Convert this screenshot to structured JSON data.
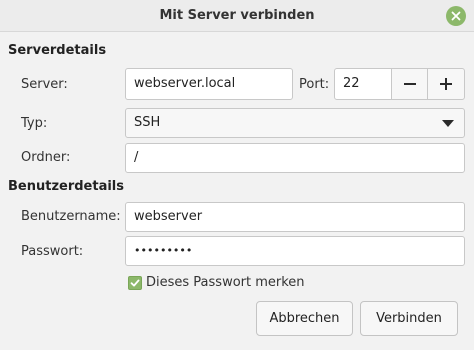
{
  "window": {
    "title": "Mit Server verbinden"
  },
  "server_details": {
    "heading": "Serverdetails",
    "server_label": "Server:",
    "server_value": "webserver.local",
    "port_label": "Port:",
    "port_value": "22",
    "type_label": "Typ:",
    "type_value": "SSH",
    "folder_label": "Ordner:",
    "folder_value": "/"
  },
  "user_details": {
    "heading": "Benutzerdetails",
    "username_label": "Benutzername:",
    "username_value": "webserver",
    "password_label": "Passwort:",
    "password_value": "•••••••••",
    "remember_label": "Dieses Passwort merken",
    "remember_checked": true
  },
  "buttons": {
    "cancel_label": "Abbrechen",
    "connect_label": "Verbinden"
  },
  "colors": {
    "accent": "#8cb86a"
  }
}
